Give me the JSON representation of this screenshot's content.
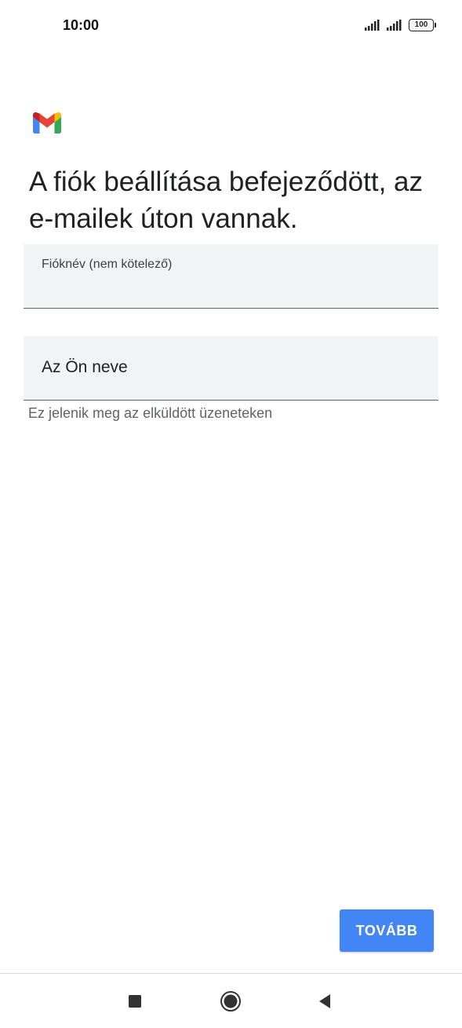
{
  "status_bar": {
    "time": "10:00",
    "battery": "100",
    "icons": [
      "signal-icon",
      "signal-icon",
      "battery-icon"
    ]
  },
  "app": {
    "logo_icon": "gmail-logo-icon"
  },
  "headline": "A fiók beállítása befejeződött, az e-mailek úton vannak.",
  "fields": {
    "account_name": {
      "label": "Fióknév (nem kötelező)",
      "value": ""
    },
    "your_name": {
      "placeholder": "Az Ön neve",
      "helper": "Ez jelenik meg az elküldött üzeneteken"
    }
  },
  "actions": {
    "next_label": "TOVÁBB"
  },
  "nav_bar": {
    "icons": [
      "recents-icon",
      "home-icon",
      "back-icon"
    ]
  },
  "colors": {
    "accent": "#4285f4",
    "field_bg": "#f1f3f4",
    "text_primary": "#202124",
    "text_secondary": "#5f6368"
  }
}
